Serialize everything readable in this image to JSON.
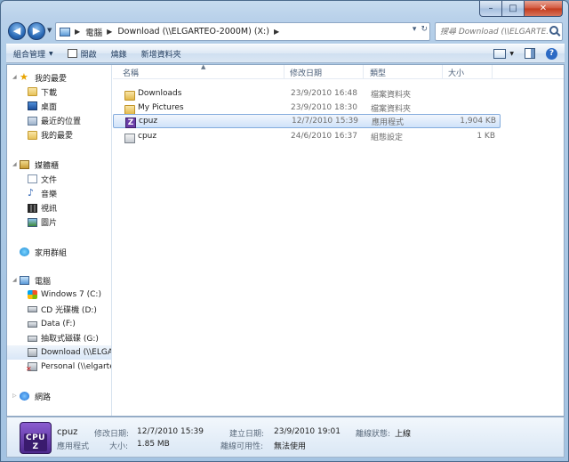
{
  "window": {
    "caption_min": "–",
    "caption_max": "□",
    "caption_close": "✕"
  },
  "address": {
    "segments": [
      "電腦",
      "Download (\\\\ELGARTEO-2000M) (X:)"
    ],
    "refresh_glyph": "↻",
    "dropdown_glyph": "▾"
  },
  "search": {
    "placeholder": "搜尋 Download (\\\\ELGARTE..."
  },
  "toolbar": {
    "organize": "組合管理",
    "open": "開啟",
    "burn": "燒錄",
    "new_folder": "新增資料夾",
    "help": "?"
  },
  "nav": {
    "favorites": {
      "label": "我的最愛",
      "items": [
        "下載",
        "桌面",
        "最近的位置",
        "我的最愛"
      ]
    },
    "libraries": {
      "label": "媒體櫃",
      "items": [
        "文件",
        "音樂",
        "視訊",
        "圖片"
      ]
    },
    "homegroup": {
      "label": "家用群組"
    },
    "computer": {
      "label": "電腦",
      "items": [
        "Windows 7 (C:)",
        "CD 光碟機 (D:)",
        "Data (F:)",
        "抽取式磁碟 (G:)",
        "Download (\\\\ELGA",
        "Personal (\\\\elgarte"
      ]
    },
    "network": {
      "label": "網路"
    }
  },
  "columns": {
    "name": "名稱",
    "date": "修改日期",
    "type": "類型",
    "size": "大小"
  },
  "files": [
    {
      "name": "Downloads",
      "date": "23/9/2010 16:48",
      "type": "檔案資料夾",
      "size": "",
      "icon": "folder"
    },
    {
      "name": "My Pictures",
      "date": "23/9/2010 18:30",
      "type": "檔案資料夾",
      "size": "",
      "icon": "folder"
    },
    {
      "name": "cpuz",
      "date": "12/7/2010 15:39",
      "type": "應用程式",
      "size": "1,904 KB",
      "icon": "exe"
    },
    {
      "name": "cpuz",
      "date": "24/6/2010 16:37",
      "type": "組態設定",
      "size": "1 KB",
      "icon": "cfg"
    }
  ],
  "details": {
    "thumb_text": "CPU Z",
    "name": "cpuz",
    "kind": "應用程式",
    "modified_label": "修改日期:",
    "modified": "12/7/2010 15:39",
    "size_label": "大小:",
    "size": "1.85 MB",
    "created_label": "建立日期:",
    "created": "23/9/2010 19:01",
    "availability_label": "離線可用性:",
    "availability": "無法使用",
    "offline_label": "離線狀態:",
    "offline": "上線"
  },
  "colors": {
    "selection_border": "#84acdd",
    "frame": "#b9d1ea"
  }
}
